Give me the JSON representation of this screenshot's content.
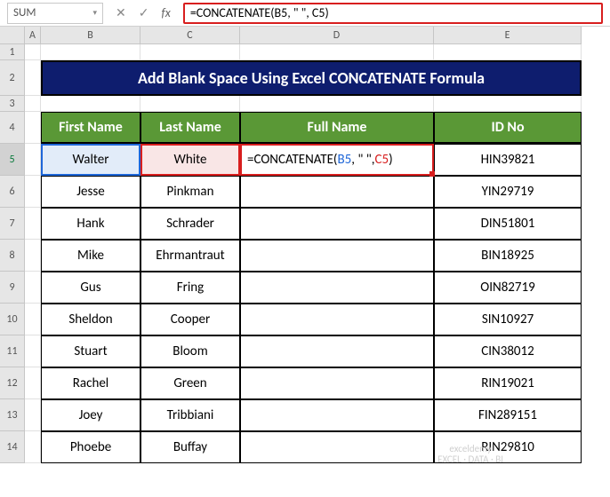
{
  "formula_bar": {
    "name_box": "SUM",
    "formula_text_plain": "=CONCATENATE(B5, \" \", C5)"
  },
  "columns": [
    "A",
    "B",
    "C",
    "D",
    "E"
  ],
  "row_numbers": [
    "1",
    "2",
    "3",
    "4",
    "5",
    "6",
    "7",
    "8",
    "9",
    "10",
    "11",
    "12",
    "13",
    "14"
  ],
  "title": "Add Blank Space Using Excel CONCATENATE Formula",
  "headers": {
    "first": "First Name",
    "last": "Last Name",
    "full": "Full Name",
    "id": "ID No"
  },
  "rows": [
    {
      "first": "Walter",
      "last": "White",
      "id": "HIN39821",
      "is_active": true
    },
    {
      "first": "Jesse",
      "last": "Pinkman",
      "id": "YIN29719",
      "is_active": false
    },
    {
      "first": "Hank",
      "last": "Schrader",
      "id": "DIN51801",
      "is_active": false
    },
    {
      "first": "Mike",
      "last": "Ehrmantraut",
      "id": "BIN18925",
      "is_active": false
    },
    {
      "first": "Gus",
      "last": "Fring",
      "id": "OIN82719",
      "is_active": false
    },
    {
      "first": "Sheldon",
      "last": "Cooper",
      "id": "SIN10927",
      "is_active": false
    },
    {
      "first": "Stuart",
      "last": "Bloom",
      "id": "CIN38012",
      "is_active": false
    },
    {
      "first": "Rachel",
      "last": "Green",
      "id": "RIN19021",
      "is_active": false
    },
    {
      "first": "Joey",
      "last": "Tribbiani",
      "id": "FIN289151",
      "is_active": false
    },
    {
      "first": "Phoebe",
      "last": "Buffay",
      "id": "RIN29810",
      "is_active": false
    }
  ],
  "cell_formula": {
    "prefix": "=CONCATENATE(",
    "ref1": "B5",
    "mid1": ", \" \", ",
    "ref2": "C5",
    "suffix": ")"
  },
  "watermark": {
    "line1": "exceldemy",
    "line2": "EXCEL · DATA · BI"
  }
}
